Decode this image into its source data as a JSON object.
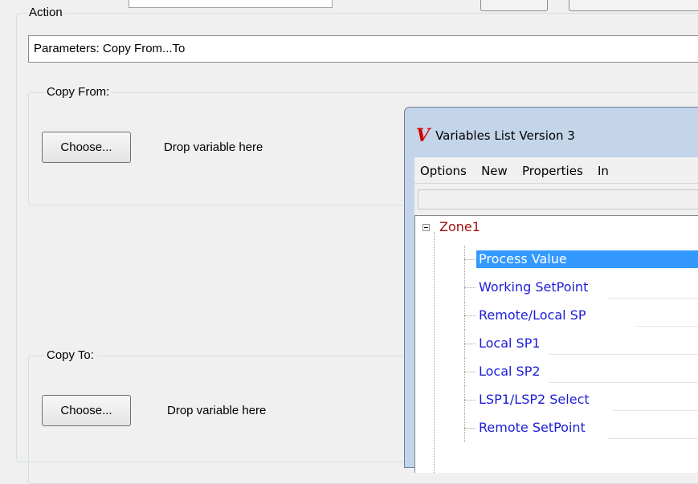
{
  "action_group": {
    "legend": "Action",
    "parameters_value": "Parameters: Copy From...To"
  },
  "copy_from": {
    "legend": "Copy From:",
    "choose_label": "Choose...",
    "drop_label": "Drop variable here"
  },
  "copy_to": {
    "legend": "Copy To:",
    "choose_label": "Choose...",
    "drop_label": "Drop variable here"
  },
  "variables_window": {
    "title": "Variables List Version 3",
    "logo_glyph": "V",
    "menu": [
      "Options",
      "New",
      "Properties",
      "In"
    ],
    "tree": {
      "root_label": "Zone1",
      "items": [
        {
          "label": "Process Value",
          "selected": true
        },
        {
          "label": "Working SetPoint",
          "selected": false
        },
        {
          "label": "Remote/Local SP",
          "selected": false
        },
        {
          "label": "Local SP1",
          "selected": false
        },
        {
          "label": "Local SP2",
          "selected": false
        },
        {
          "label": "LSP1/LSP2 Select",
          "selected": false
        },
        {
          "label": "Remote SetPoint",
          "selected": false
        }
      ]
    }
  },
  "colors": {
    "selection": "#3399ff",
    "tree_item_text": "#1c1cd8",
    "root_text": "#a01010",
    "logo": "#d40000"
  }
}
